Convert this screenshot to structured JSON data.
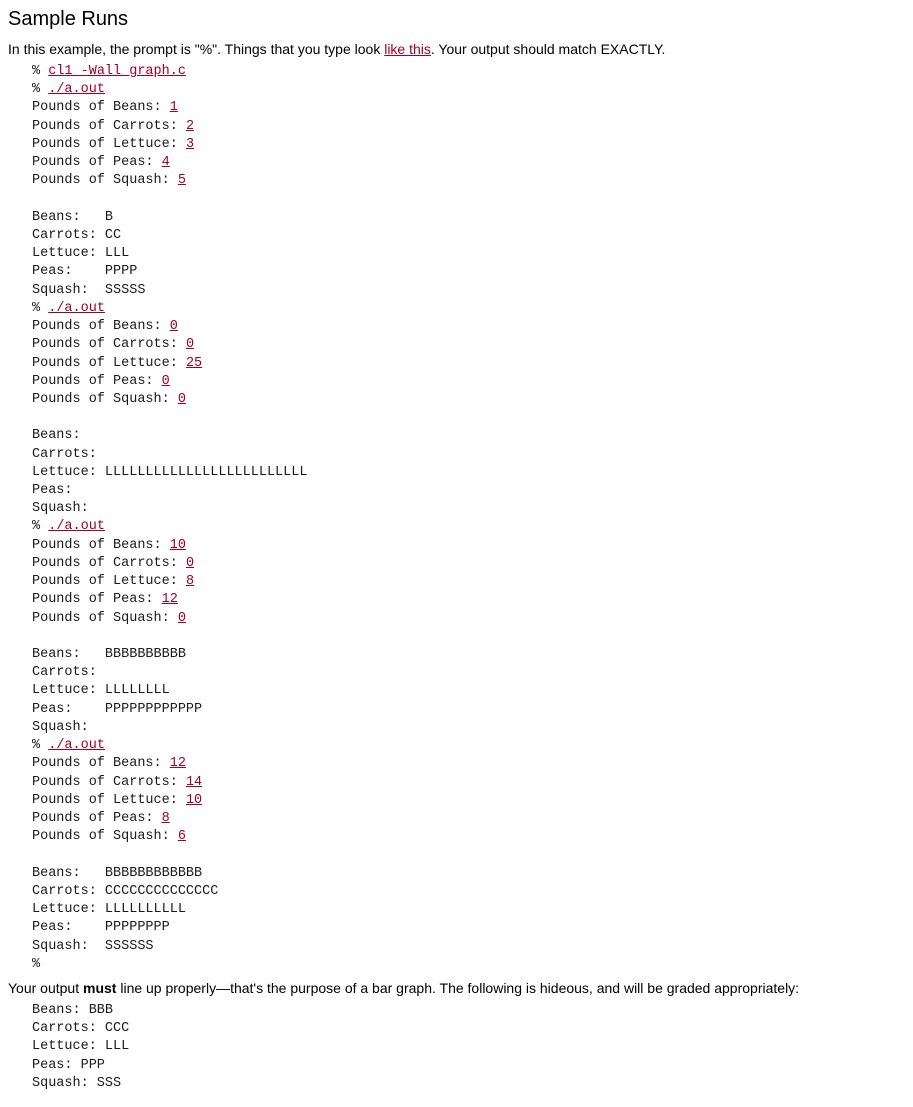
{
  "title": "Sample Runs",
  "intro_pre": "In this example, the prompt is \"%\". Things that you type look ",
  "intro_link": "like this",
  "intro_post": ". Your output should match EXACTLY.",
  "prompt": "%",
  "compile_cmd": "cl1 -Wall graph.c",
  "run_cmd": "./a.out",
  "prompts": {
    "beans": "Pounds of Beans: ",
    "carrots": "Pounds of Carrots: ",
    "lettuce": "Pounds of Lettuce: ",
    "peas": "Pounds of Peas: ",
    "squash": "Pounds of Squash: "
  },
  "labels": {
    "beans": "Beans:   ",
    "carrots": "Carrots: ",
    "lettuce": "Lettuce: ",
    "peas": "Peas:    ",
    "squash": "Squash:  "
  },
  "runs": [
    {
      "inputs": {
        "beans": "1",
        "carrots": "2",
        "lettuce": "3",
        "peas": "4",
        "squash": "5"
      },
      "bars": {
        "beans": "B",
        "carrots": "CC",
        "lettuce": "LLL",
        "peas": "PPPP",
        "squash": "SSSSS"
      }
    },
    {
      "inputs": {
        "beans": "0",
        "carrots": "0",
        "lettuce": "25",
        "peas": "0",
        "squash": "0"
      },
      "bars": {
        "beans": "",
        "carrots": "",
        "lettuce": "LLLLLLLLLLLLLLLLLLLLLLLLL",
        "peas": "",
        "squash": ""
      }
    },
    {
      "inputs": {
        "beans": "10",
        "carrots": "0",
        "lettuce": "8",
        "peas": "12",
        "squash": "0"
      },
      "bars": {
        "beans": "BBBBBBBBBB",
        "carrots": "",
        "lettuce": "LLLLLLLL",
        "peas": "PPPPPPPPPPPP",
        "squash": ""
      }
    },
    {
      "inputs": {
        "beans": "12",
        "carrots": "14",
        "lettuce": "10",
        "peas": "8",
        "squash": "6"
      },
      "bars": {
        "beans": "BBBBBBBBBBBB",
        "carrots": "CCCCCCCCCCCCCC",
        "lettuce": "LLLLLLLLLL",
        "peas": "PPPPPPPP",
        "squash": "SSSSSS"
      }
    }
  ],
  "footer_pre": "Your output ",
  "footer_bold": "must",
  "footer_post": " line up properly—that's the purpose of a bar graph. The following is hideous, and will be graded appropriately:",
  "bad_example": {
    "beans": "Beans: BBB",
    "carrots": "Carrots: CCC",
    "lettuce": "Lettuce: LLL",
    "peas": "Peas: PPP",
    "squash": "Squash: SSS"
  }
}
